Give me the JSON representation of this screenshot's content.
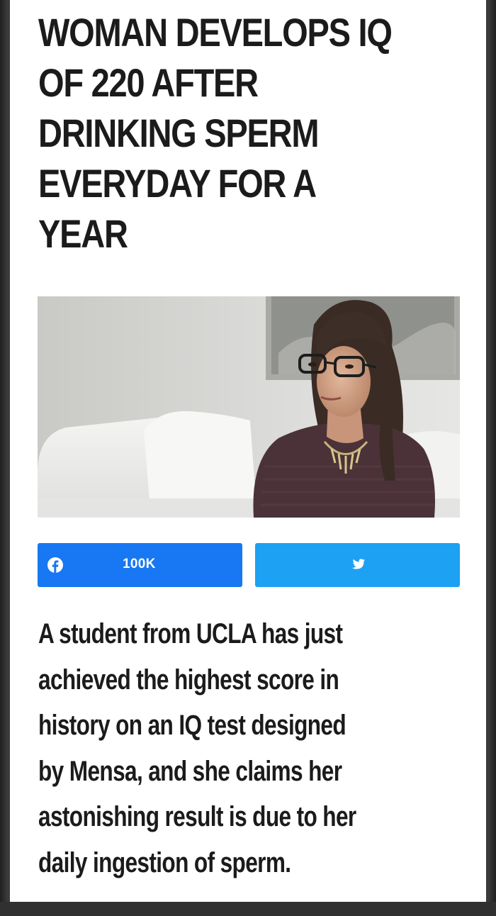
{
  "article": {
    "headline_lines": [
      "WOMAN DEVELOPS IQ",
      "OF 220 AFTER",
      "DRINKING SPERM",
      "EVERYDAY FOR A",
      "YEAR"
    ],
    "image": {
      "subject": "woman-with-glasses-on-white-sofa"
    },
    "share": {
      "facebook": {
        "icon": "facebook-icon",
        "count": "100K",
        "color": "#1877f2"
      },
      "twitter": {
        "icon": "twitter-icon",
        "color": "#1da1f2"
      }
    },
    "body_lines": [
      "A student from UCLA has just",
      "achieved the highest score in",
      "history on an IQ test designed",
      "by Mensa, and she claims her",
      "astonishing result is due to her",
      "daily ingestion of sperm."
    ]
  }
}
